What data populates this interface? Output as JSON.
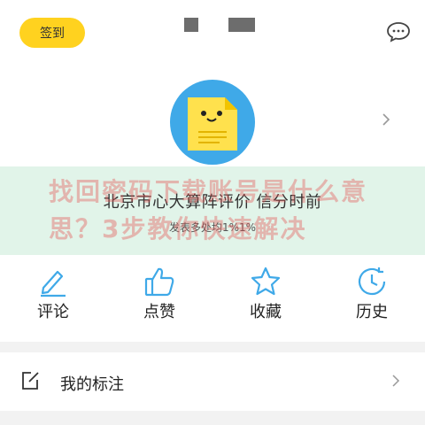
{
  "header": {
    "signin_label": "签到",
    "message_icon": "chat-bubble-icon"
  },
  "profile": {
    "avatar_icon": "document-mascot-icon",
    "name_text": "北京市心大算阵评价 信分时前",
    "sub_text": "发表多处均1%1%"
  },
  "watermark": {
    "text": "找回密码下载账号是什么意思？3步教你快速解决"
  },
  "quick_actions": [
    {
      "label": "评论",
      "icon": "pen-icon"
    },
    {
      "label": "点赞",
      "icon": "thumbs-up-icon"
    },
    {
      "label": "收藏",
      "icon": "star-icon"
    },
    {
      "label": "历史",
      "icon": "clock-history-icon"
    }
  ],
  "menu": {
    "annotations_label": "我的标注"
  },
  "colors": {
    "accent": "#ffd21f",
    "icon_blue": "#3fa9e8",
    "avatar_bg": "#3fa9e8",
    "watermark_text": "#e45050"
  }
}
